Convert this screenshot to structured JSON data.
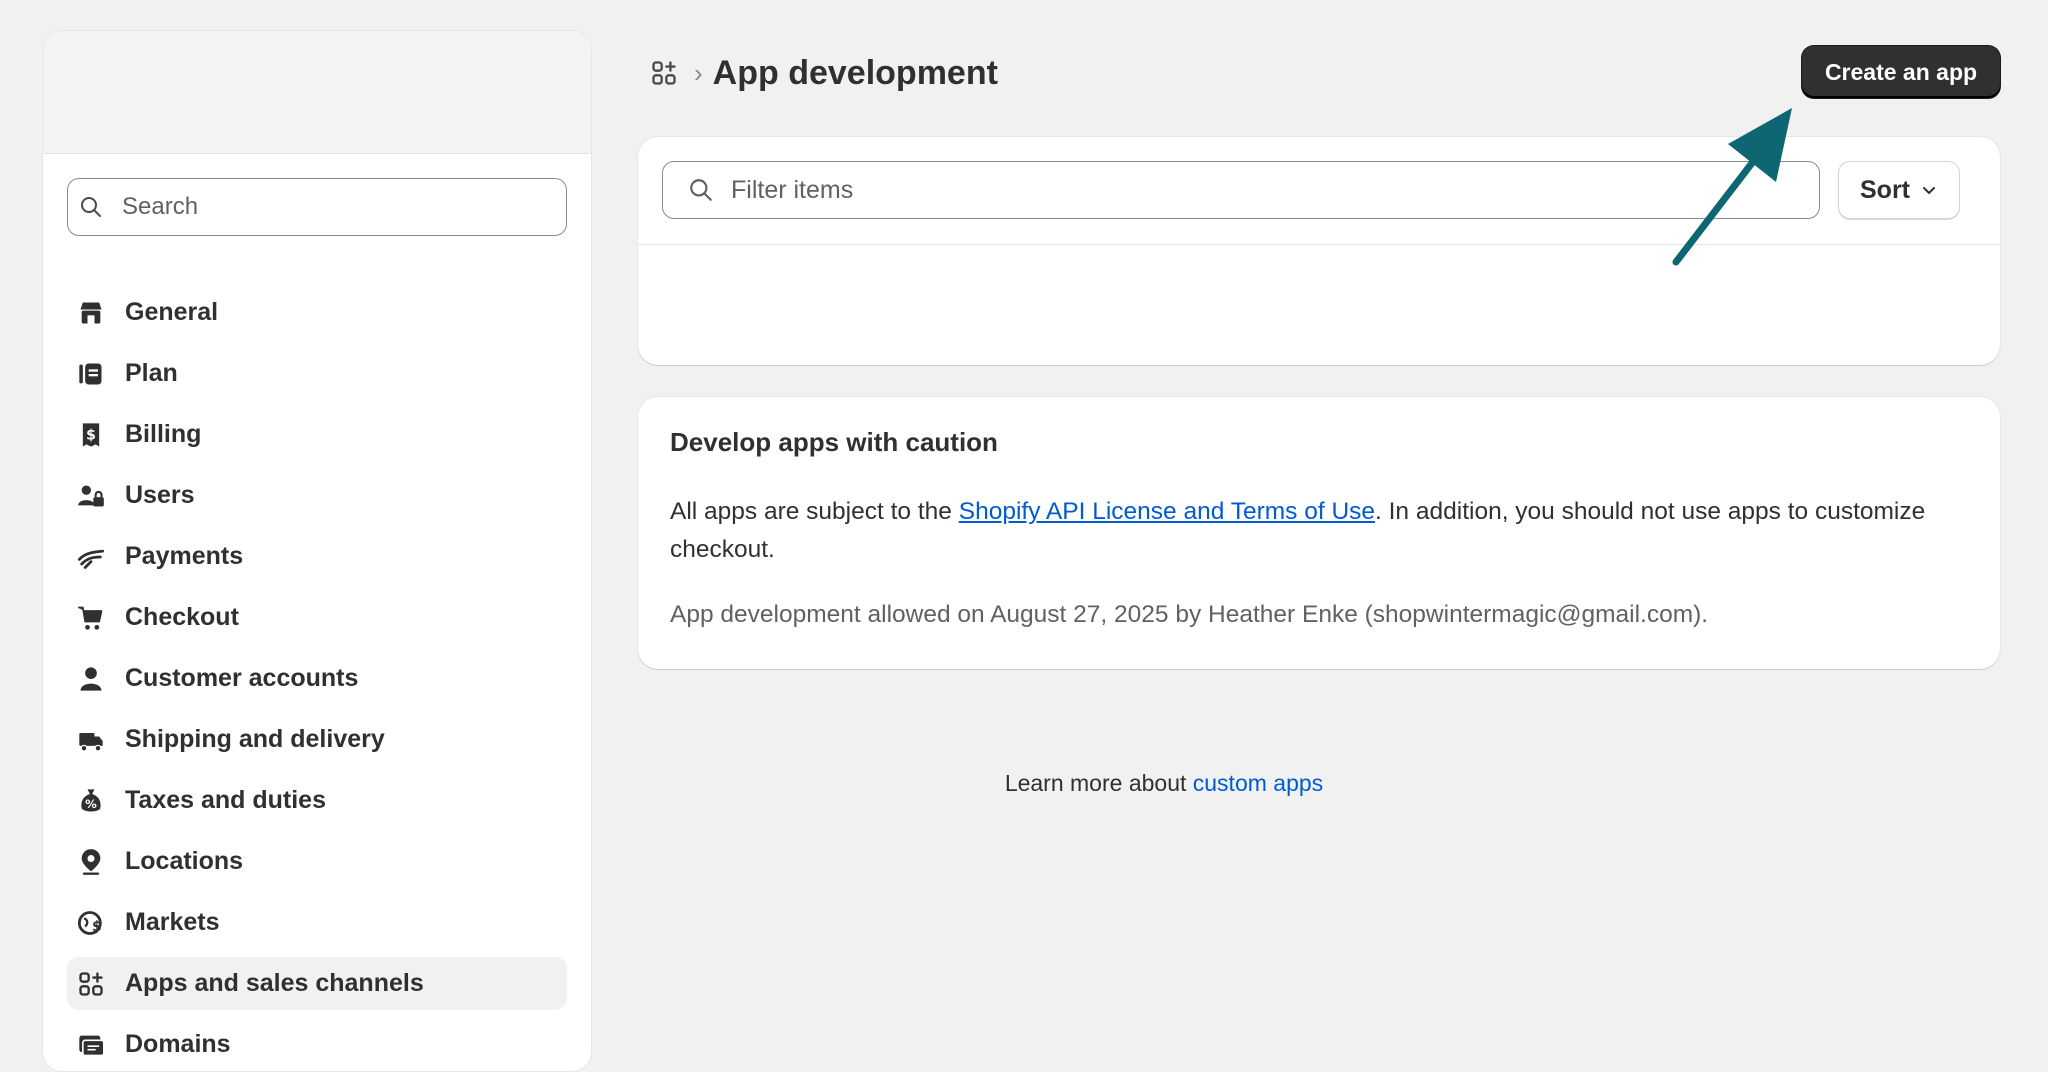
{
  "sidebar": {
    "search_placeholder": "Search",
    "items": [
      {
        "label": "General",
        "icon": "store-icon"
      },
      {
        "label": "Plan",
        "icon": "plan-icon"
      },
      {
        "label": "Billing",
        "icon": "billing-icon"
      },
      {
        "label": "Users",
        "icon": "users-icon"
      },
      {
        "label": "Payments",
        "icon": "payments-icon"
      },
      {
        "label": "Checkout",
        "icon": "cart-icon"
      },
      {
        "label": "Customer accounts",
        "icon": "person-icon"
      },
      {
        "label": "Shipping and delivery",
        "icon": "truck-icon"
      },
      {
        "label": "Taxes and duties",
        "icon": "tax-icon"
      },
      {
        "label": "Locations",
        "icon": "location-icon"
      },
      {
        "label": "Markets",
        "icon": "globe-icon"
      },
      {
        "label": "Apps and sales channels",
        "icon": "apps-icon",
        "active": true
      },
      {
        "label": "Domains",
        "icon": "domains-icon"
      }
    ]
  },
  "header": {
    "breadcrumb_icon": "apps-icon",
    "separator": "›",
    "title": "App development",
    "create_button": "Create an app"
  },
  "filter": {
    "placeholder": "Filter items",
    "sort_label": "Sort"
  },
  "caution": {
    "title": "Develop apps with caution",
    "text_before_link": "All apps are subject to the ",
    "link_text": "Shopify API License and Terms of Use",
    "text_after_link": ". In addition, you should not use apps to customize checkout.",
    "note": "App development allowed on August 27, 2025 by Heather Enke (shopwintermagic@gmail.com)."
  },
  "footer": {
    "learn_prefix": "Learn more about ",
    "learn_link": "custom apps"
  },
  "colors": {
    "background": "#f1f1f1",
    "primary_button": "#303030",
    "link": "#005bd3",
    "annotation_arrow": "#0e6673"
  }
}
